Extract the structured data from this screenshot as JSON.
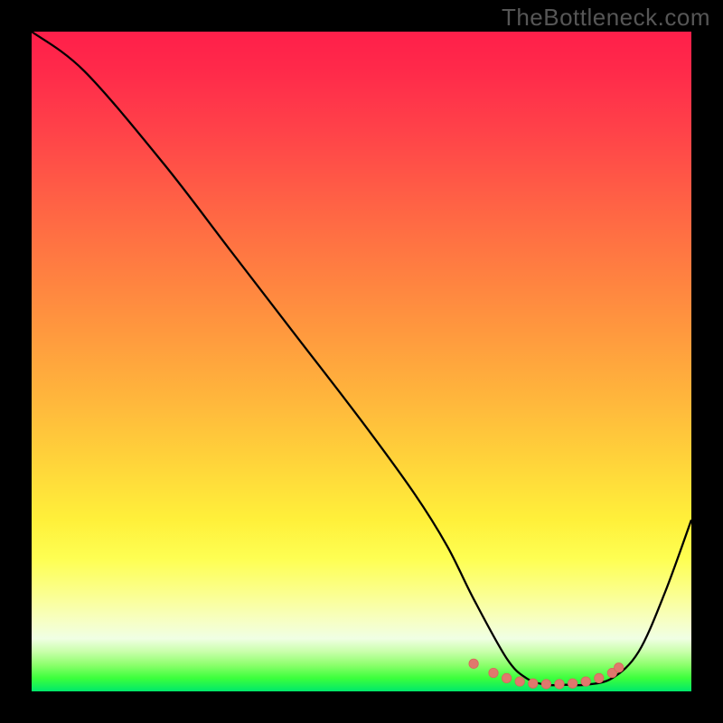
{
  "watermark": "TheBottleneck.com",
  "chart_data": {
    "type": "line",
    "title": "",
    "xlabel": "",
    "ylabel": "",
    "xlim": [
      0,
      100
    ],
    "ylim": [
      0,
      100
    ],
    "grid": false,
    "series": [
      {
        "name": "bottleneck-curve",
        "x": [
          0,
          8,
          20,
          30,
          40,
          50,
          58,
          63,
          67,
          72,
          75,
          78,
          81,
          84,
          88,
          92,
          96,
          100
        ],
        "y": [
          100,
          94,
          80,
          67,
          54,
          41,
          30,
          22,
          14,
          5,
          2,
          1,
          1,
          1,
          2,
          6,
          15,
          26
        ]
      }
    ],
    "markers": {
      "name": "optimal-range",
      "x": [
        67,
        70,
        72,
        74,
        76,
        78,
        80,
        82,
        84,
        86,
        88,
        89
      ],
      "y": [
        4.2,
        2.8,
        2.0,
        1.5,
        1.2,
        1.1,
        1.1,
        1.2,
        1.5,
        2.0,
        2.8,
        3.6
      ]
    },
    "background": {
      "type": "vertical-spectral",
      "stops": [
        {
          "pos": 0,
          "color": "#ff1f4a"
        },
        {
          "pos": 50,
          "color": "#ffb03c"
        },
        {
          "pos": 80,
          "color": "#feff53"
        },
        {
          "pos": 100,
          "color": "#00e86b"
        }
      ]
    }
  }
}
